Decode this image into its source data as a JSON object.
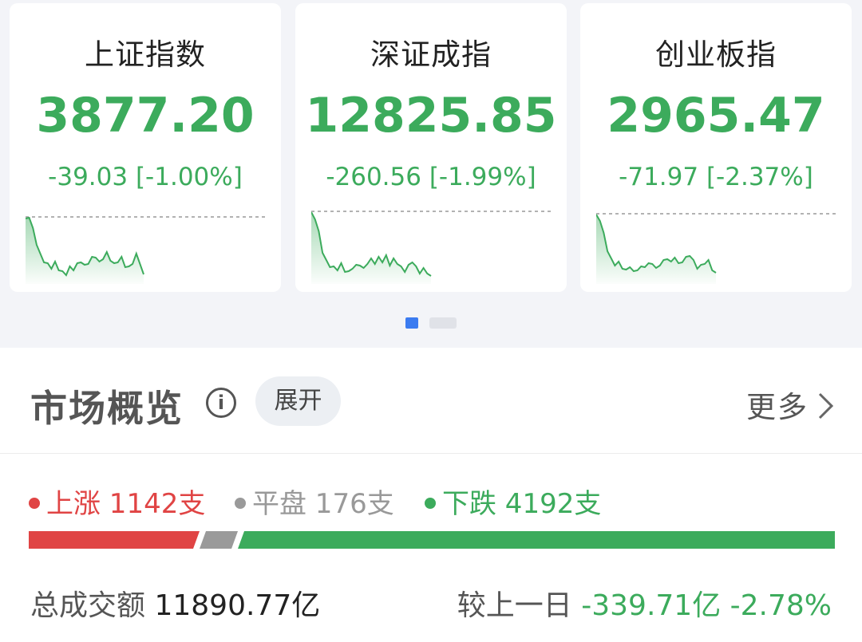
{
  "indices": [
    {
      "name": "上证指数",
      "price": "3877.20",
      "change": "-39.03 [-1.00%]"
    },
    {
      "name": "深证成指",
      "price": "12825.85",
      "change": "-260.56 [-1.99%]"
    },
    {
      "name": "创业板指",
      "price": "2965.47",
      "change": "-71.97 [-2.37%]"
    }
  ],
  "pager": {
    "active": 1,
    "total": 2
  },
  "overview": {
    "title": "市场概览",
    "expand_label": "展开",
    "more_label": "更多",
    "up_label": "上涨 1142支",
    "flat_label": "平盘 176支",
    "down_label": "下跌 4192支",
    "up_count": 1142,
    "flat_count": 176,
    "down_count": 4192,
    "volume_label": "总成交额",
    "volume_value": "11890.77亿",
    "compare_label": "较上一日",
    "compare_value": "-339.71亿 -2.78%"
  },
  "colors": {
    "down_green": "#3cab5c",
    "up_red": "#e04444",
    "flat_gray": "#9a9a9a",
    "accent_blue": "#3b7bf0"
  }
}
